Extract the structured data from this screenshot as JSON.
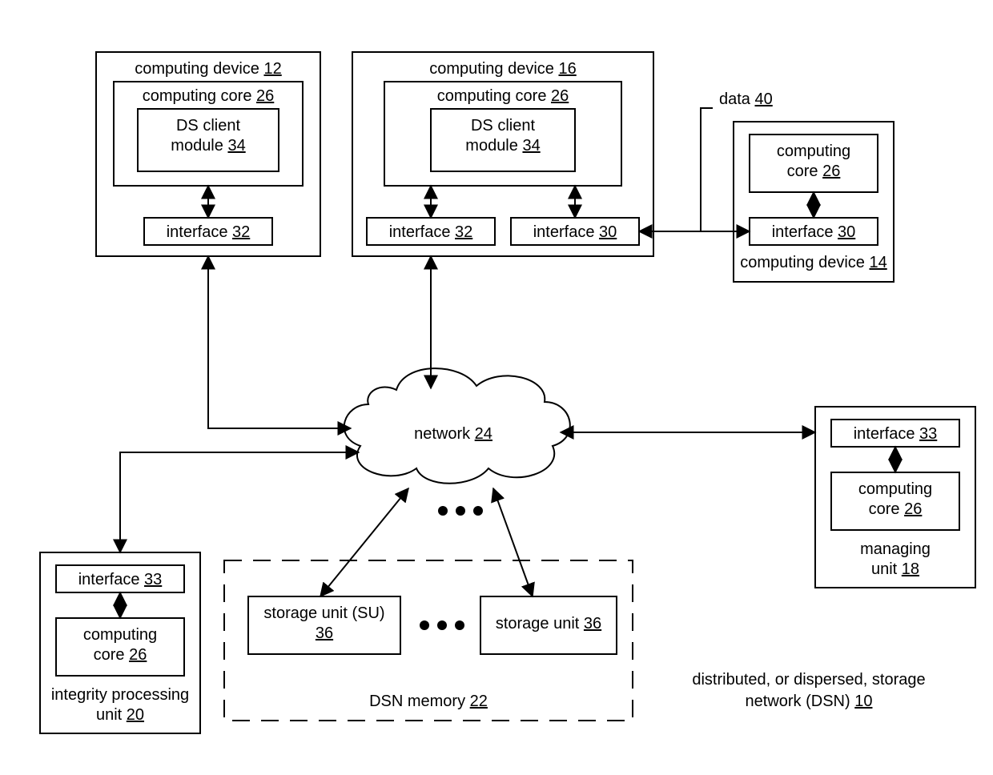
{
  "device12": {
    "title": "computing device",
    "num": "12",
    "core": {
      "title": "computing core",
      "num": "26",
      "client": {
        "title": "DS client",
        "title2": "module",
        "num": "34"
      }
    },
    "iface": {
      "title": "interface",
      "num": "32"
    }
  },
  "device16": {
    "title": "computing device",
    "num": "16",
    "core": {
      "title": "computing core",
      "num": "26",
      "client": {
        "title": "DS client",
        "title2": "module",
        "num": "34"
      }
    },
    "iface32": {
      "title": "interface",
      "num": "32"
    },
    "iface30": {
      "title": "interface",
      "num": "30"
    }
  },
  "device14": {
    "title": "computing device",
    "num": "14",
    "core": {
      "title": "computing",
      "title2": "core",
      "num": "26"
    },
    "iface": {
      "title": "interface",
      "num": "30"
    }
  },
  "data": {
    "title": "data",
    "num": "40"
  },
  "network": {
    "title": "network",
    "num": "24"
  },
  "managing": {
    "title": "managing",
    "title2": "unit",
    "num": "18",
    "iface": {
      "title": "interface",
      "num": "33"
    },
    "core": {
      "title": "computing",
      "title2": "core",
      "num": "26"
    }
  },
  "integrity": {
    "title": "integrity  processing",
    "title2": "unit",
    "num": "20",
    "iface": {
      "title": "interface",
      "num": "33"
    },
    "core": {
      "title": "computing",
      "title2": "core",
      "num": "26"
    }
  },
  "dsn_mem": {
    "title": "DSN memory",
    "num": "22",
    "su1": {
      "title": "storage unit (SU)",
      "num": "36"
    },
    "su2": {
      "title": "storage unit",
      "num": "36"
    }
  },
  "overall": {
    "line1": "distributed, or dispersed, storage",
    "line2": "network (DSN)",
    "num": "10"
  }
}
